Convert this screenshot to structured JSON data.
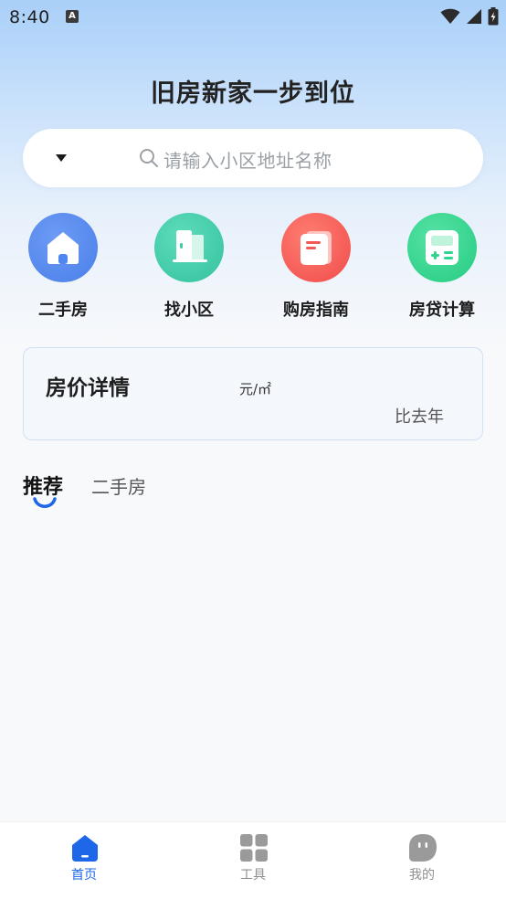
{
  "status_bar": {
    "time": "8:40",
    "notification_badge": "A"
  },
  "headline": "旧房新家一步到位",
  "search": {
    "placeholder": "请输入小区地址名称"
  },
  "quick_actions": [
    {
      "label": "二手房",
      "icon": "house-icon",
      "color": "#4f86f0"
    },
    {
      "label": "找小区",
      "icon": "building-door-icon",
      "color": "#3fcca8"
    },
    {
      "label": "购房指南",
      "icon": "book-icon",
      "color": "#f45a55"
    },
    {
      "label": "房贷计算",
      "icon": "calculator-icon",
      "color": "#2dd58e"
    }
  ],
  "price_card": {
    "title": "房价详情",
    "unit": "元/㎡",
    "compare": "比去年"
  },
  "tabs": [
    {
      "label": "推荐",
      "active": true
    },
    {
      "label": "二手房",
      "active": false
    }
  ],
  "bottom_nav": [
    {
      "label": "首页",
      "icon": "home-icon",
      "active": true
    },
    {
      "label": "工具",
      "icon": "grid-icon",
      "active": false
    },
    {
      "label": "我的",
      "icon": "profile-face-icon",
      "active": false
    }
  ],
  "colors": {
    "accent": "#1d67e8",
    "inactive": "#8f8f8f"
  }
}
